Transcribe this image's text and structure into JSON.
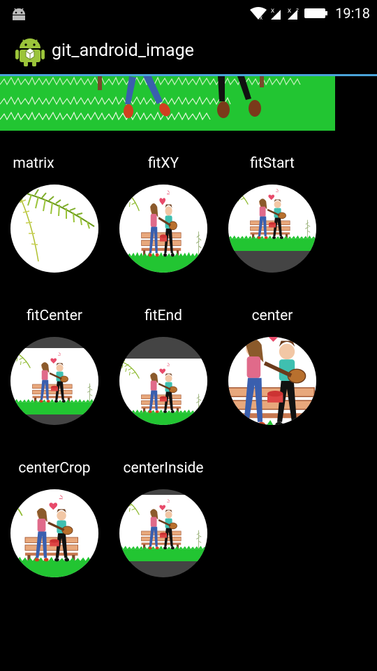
{
  "status_bar": {
    "time": "19:18",
    "icons": [
      "android-notification-icon",
      "wifi-icon",
      "signal-1-icon",
      "signal-2-icon",
      "battery-icon"
    ]
  },
  "action_bar": {
    "title": "git_android_image",
    "icon": "android-app-icon"
  },
  "banner": {
    "description_icon": "couple-on-grass-banner"
  },
  "scale_types": [
    {
      "label": "matrix"
    },
    {
      "label": "fitXY"
    },
    {
      "label": "fitStart"
    },
    {
      "label": "fitCenter"
    },
    {
      "label": "fitEnd"
    },
    {
      "label": "center"
    },
    {
      "label": "centerCrop"
    },
    {
      "label": "centerInside"
    }
  ],
  "colors": {
    "accent_line": "#4aa3d9",
    "grass": "#22c532",
    "thumb_background": "#444444"
  }
}
